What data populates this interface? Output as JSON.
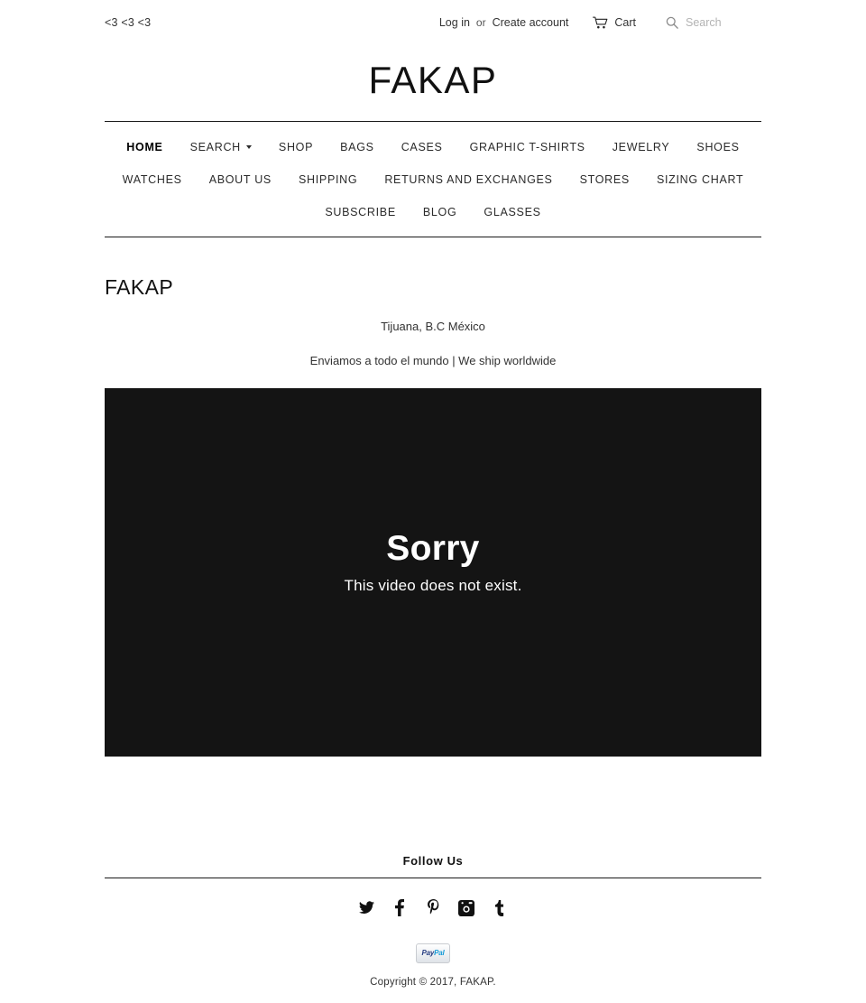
{
  "topbar": {
    "announcement": "<3 <3 <3",
    "login_label": "Log in",
    "or_label": "or",
    "create_account_label": "Create account",
    "cart_label": "Cart",
    "cart_icon": "shopping-cart-icon",
    "search_icon": "search-icon",
    "search_placeholder": "Search",
    "search_value": ""
  },
  "header": {
    "logo_text": "FAKAP"
  },
  "nav": {
    "items": [
      {
        "label": "HOME",
        "active": true,
        "has_dropdown": false
      },
      {
        "label": "SEARCH",
        "active": false,
        "has_dropdown": true
      },
      {
        "label": "SHOP",
        "active": false,
        "has_dropdown": false
      },
      {
        "label": "BAGS",
        "active": false,
        "has_dropdown": false
      },
      {
        "label": "CASES",
        "active": false,
        "has_dropdown": false
      },
      {
        "label": "GRAPHIC T-SHIRTS",
        "active": false,
        "has_dropdown": false
      },
      {
        "label": "JEWELRY",
        "active": false,
        "has_dropdown": false
      },
      {
        "label": "SHOES",
        "active": false,
        "has_dropdown": false
      },
      {
        "label": "WATCHES",
        "active": false,
        "has_dropdown": false
      },
      {
        "label": "ABOUT US",
        "active": false,
        "has_dropdown": false
      },
      {
        "label": "SHIPPING",
        "active": false,
        "has_dropdown": false
      },
      {
        "label": "RETURNS AND EXCHANGES",
        "active": false,
        "has_dropdown": false
      },
      {
        "label": "STORES",
        "active": false,
        "has_dropdown": false
      },
      {
        "label": "SIZING CHART",
        "active": false,
        "has_dropdown": false
      },
      {
        "label": "SUBSCRIBE",
        "active": false,
        "has_dropdown": false
      },
      {
        "label": "BLOG",
        "active": false,
        "has_dropdown": false
      },
      {
        "label": "GLASSES",
        "active": false,
        "has_dropdown": false
      }
    ]
  },
  "main": {
    "title": "FAKAP",
    "line1": "Tijuana, B.C México",
    "line2": "Enviamos a todo el mundo | We ship worldwide",
    "video": {
      "heading": "Sorry",
      "message": "This video does not exist.",
      "background": "#141414"
    }
  },
  "footer": {
    "follow_title": "Follow Us",
    "social": [
      {
        "name": "twitter-icon",
        "label": "Twitter"
      },
      {
        "name": "facebook-icon",
        "label": "Facebook"
      },
      {
        "name": "pinterest-icon",
        "label": "Pinterest"
      },
      {
        "name": "instagram-icon",
        "label": "Instagram"
      },
      {
        "name": "tumblr-icon",
        "label": "Tumblr"
      }
    ],
    "payment": {
      "name": "paypal-icon",
      "pay": "Pay",
      "pal": "Pal"
    },
    "copyright": "Copyright © 2017, FAKAP."
  }
}
